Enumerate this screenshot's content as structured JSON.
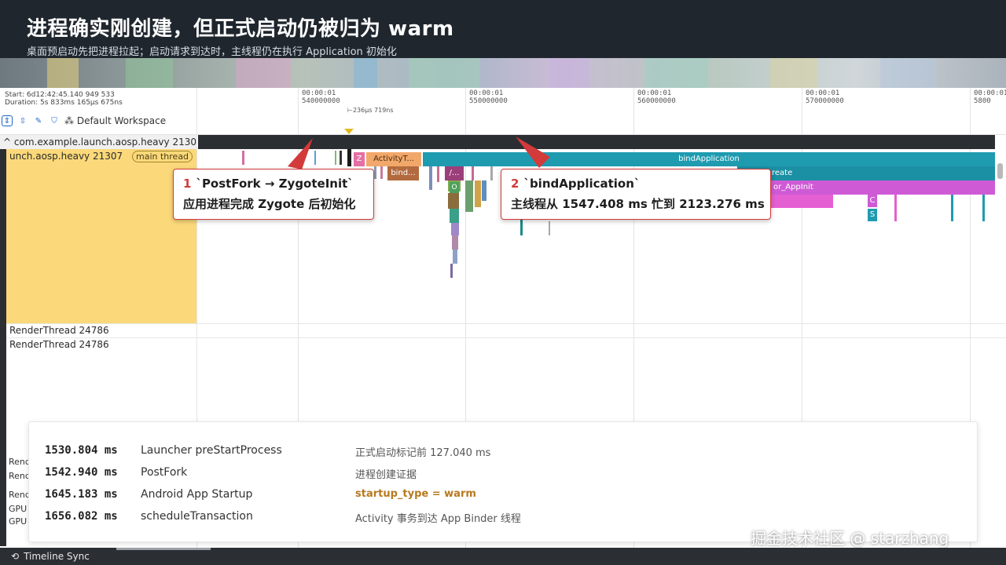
{
  "slide": {
    "title": "进程确实刚创建，但正式启动仍被归为 warm",
    "subtitle": "桌面预启动先把进程拉起；启动请求到达时，主线程仍在执行 Application 初始化"
  },
  "ruler": {
    "start": "Start: 6d12:42:45.140 949 533",
    "duration": "Duration: 5s 833ms 165μs 675ns",
    "delta": "236μs 719ns",
    "ticks": [
      {
        "time": "00:00:01",
        "ns": "540000000"
      },
      {
        "time": "00:00:01",
        "ns": "550000000"
      },
      {
        "time": "00:00:01",
        "ns": "560000000"
      },
      {
        "time": "00:00:01",
        "ns": "570000000"
      },
      {
        "time": "00:00:01",
        "ns": "5800"
      }
    ]
  },
  "toolbar": {
    "workspace": "Default Workspace"
  },
  "tracks": {
    "process": "com.example.launch.aosp.heavy 21307",
    "main_thread": "unch.aosp.heavy 21307",
    "main_badge": "main thread",
    "render1": "RenderThread 24786",
    "render2": "RenderThread 24786",
    "truncated": [
      "Rend",
      "Rend",
      "Rend",
      "GPU",
      "GPU"
    ]
  },
  "slices": {
    "z": "Z",
    "activity": "ActivityT...",
    "bind_short": "bind...",
    "slash": "/...",
    "o": "O",
    "bind_application": "bindApplication",
    "create": "reate",
    "appinit": "or_AppInit",
    "c": "C",
    "s": "S"
  },
  "callouts": {
    "one": {
      "num": "1",
      "title": "`PostFork → ZygoteInit`",
      "desc": "应用进程完成 Zygote 后初始化"
    },
    "two": {
      "num": "2",
      "title": "`bindApplication`",
      "desc": "主线程从 1547.408 ms 忙到 2123.276 ms"
    }
  },
  "events": [
    {
      "ms": "1530.804 ms",
      "event": "Launcher preStartProcess",
      "note": "正式启动标记前 127.040 ms"
    },
    {
      "ms": "1542.940 ms",
      "event": "PostFork",
      "note": "进程创建证据"
    },
    {
      "ms": "1645.183 ms",
      "event": "Android App Startup",
      "note": "startup_type = warm"
    },
    {
      "ms": "1656.082 ms",
      "event": "scheduleTransaction",
      "note": "Activity 事务到达 App Binder 线程"
    }
  ],
  "footer": {
    "tab": "Timeline Sync"
  },
  "watermark": "掘金技术社区 @ starzhang",
  "colors": {
    "header_bg": "#1f262e",
    "thread_panel": "#fbd97a",
    "bind_application": "#1f9bb0",
    "activity_slice": "#f2a86a",
    "appinit": "#cf5ad6",
    "callout_border": "#d33a3a",
    "warm_highlight": "#b7791f"
  }
}
